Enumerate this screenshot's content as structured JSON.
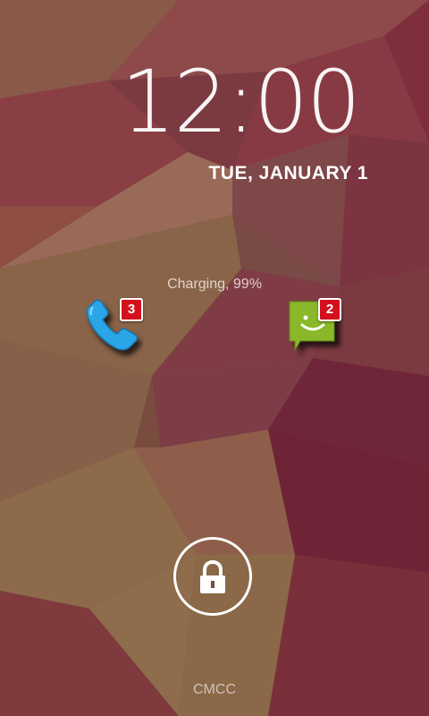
{
  "lockscreen": {
    "time": "12:00",
    "date": "TUE, JANUARY 1",
    "charging_status": "Charging, 99%",
    "carrier": "CMCC"
  },
  "notifications": {
    "phone": {
      "icon": "phone-icon",
      "count": "3"
    },
    "messages": {
      "icon": "sms-icon",
      "count": "2"
    }
  },
  "unlock": {
    "icon": "lock-icon"
  },
  "colors": {
    "badge": "#d4101c",
    "phone_icon": "#2aa6e8",
    "sms_icon": "#8ab82a",
    "wallpaper_dark": "#6e2a36",
    "wallpaper_warm": "#8a6a4a"
  }
}
